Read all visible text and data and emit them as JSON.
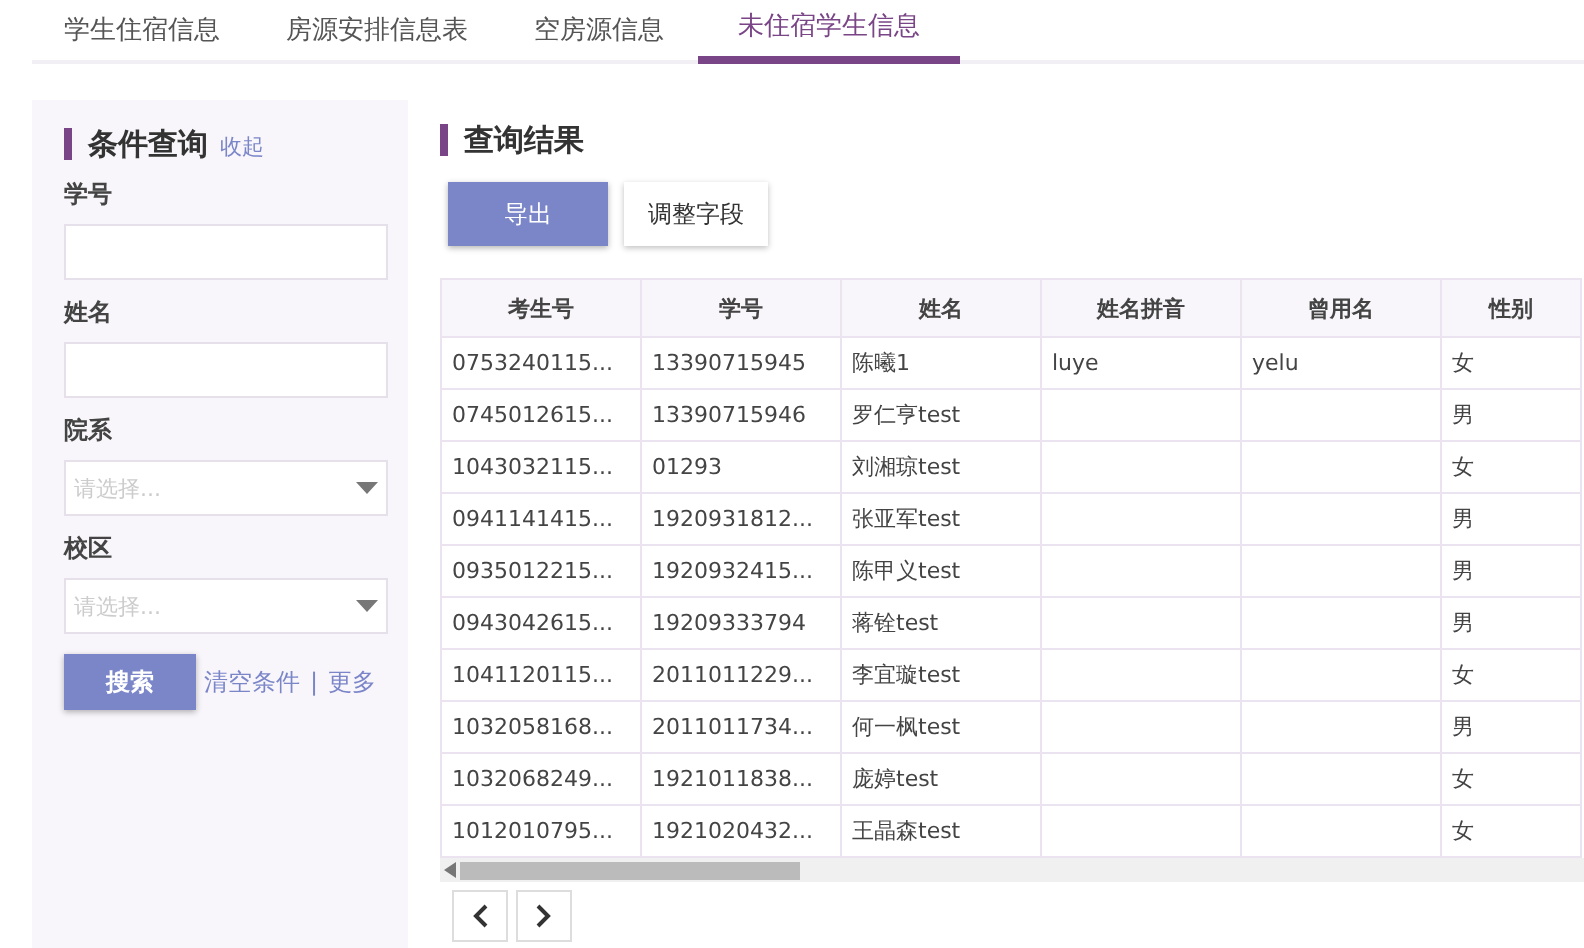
{
  "tabs": [
    {
      "label": "学生住宿信息",
      "selected": false
    },
    {
      "label": "房源安排信息表",
      "selected": false
    },
    {
      "label": "空房源信息",
      "selected": false
    },
    {
      "label": "未住宿学生信息",
      "selected": true
    }
  ],
  "filter": {
    "title": "条件查询",
    "collapse_link": "收起",
    "fields": [
      {
        "kind": "input",
        "label": "学号"
      },
      {
        "kind": "input",
        "label": "姓名"
      },
      {
        "kind": "select",
        "label": "院系",
        "placeholder": "请选择..."
      },
      {
        "kind": "select",
        "label": "校区",
        "placeholder": "请选择..."
      }
    ],
    "search_button": "搜索",
    "clear_link": "清空条件",
    "separator": "|",
    "more_link": "更多"
  },
  "results": {
    "title": "查询结果",
    "export_button": "导出",
    "adjust_button": "调整字段",
    "table": {
      "columns": [
        "考生号",
        "学号",
        "姓名",
        "姓名拼音",
        "曾用名",
        "性别"
      ],
      "rows": [
        [
          "0753240115...",
          "13390715945",
          "陈曦1",
          "luye",
          "yelu",
          "女"
        ],
        [
          "0745012615...",
          "13390715946",
          "罗仁亨test",
          "",
          "",
          "男"
        ],
        [
          "1043032115...",
          "01293",
          "刘湘琼test",
          "",
          "",
          "女"
        ],
        [
          "0941141415...",
          "1920931812...",
          "张亚军test",
          "",
          "",
          "男"
        ],
        [
          "0935012215...",
          "1920932415...",
          "陈甲义test",
          "",
          "",
          "男"
        ],
        [
          "0943042615...",
          "19209333794",
          "蒋铨test",
          "",
          "",
          "男"
        ],
        [
          "1041120115...",
          "2011011229...",
          "李宜璇test",
          "",
          "",
          "女"
        ],
        [
          "1032058168...",
          "2011011734...",
          "何一枫test",
          "",
          "",
          "男"
        ],
        [
          "1032068249...",
          "1921011838...",
          "庞婷test",
          "",
          "",
          "女"
        ],
        [
          "1012010795...",
          "1921020432...",
          "王晶森test",
          "",
          "",
          "女"
        ]
      ]
    }
  }
}
